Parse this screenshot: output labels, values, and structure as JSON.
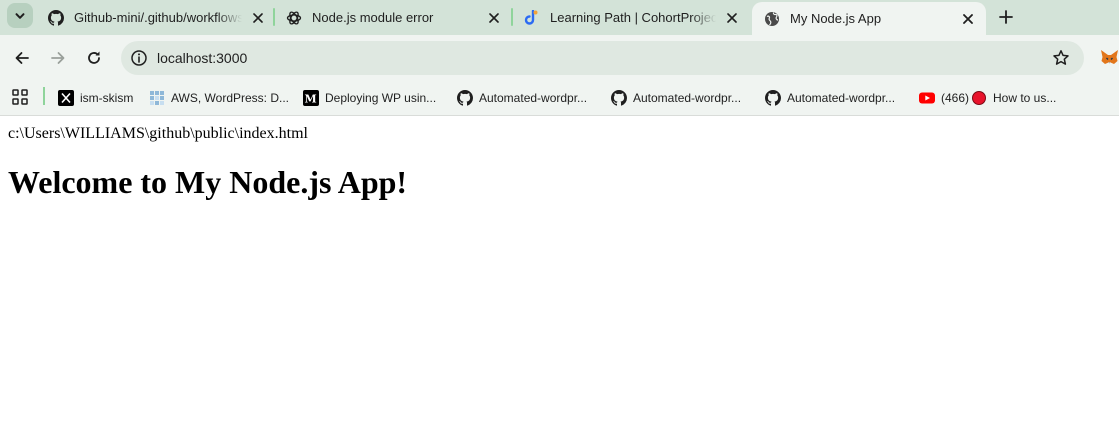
{
  "browser": {
    "tabs": [
      {
        "title": "Github-mini/.github/workflows/",
        "favicon": "github-icon",
        "active": false
      },
      {
        "title": "Node.js module error",
        "favicon": "openai-icon",
        "active": false
      },
      {
        "title": "Learning Path | CohortProject | ",
        "favicon": "cohort-icon",
        "active": false
      },
      {
        "title": "My Node.js App",
        "favicon": "globe-icon",
        "active": true
      }
    ],
    "address": "localhost:3000",
    "bookmarks": [
      {
        "label": "ism-skism",
        "icon": "x-icon"
      },
      {
        "label": "AWS, WordPress: D...",
        "icon": "aws-grid-icon"
      },
      {
        "label": "Deploying WP usin...",
        "icon": "medium-icon"
      },
      {
        "label": "Automated-wordpr...",
        "icon": "github-icon"
      },
      {
        "label": "Automated-wordpr...",
        "icon": "github-icon"
      },
      {
        "label": "Automated-wordpr...",
        "icon": "github-icon"
      },
      {
        "label": "(466)",
        "icon": "youtube-icon"
      },
      {
        "label": "How to us...",
        "icon": "red-dot-icon"
      }
    ],
    "colors": {
      "tabstrip": "#d3e3d8",
      "toolbar": "#f0f4f1",
      "omnibox": "#dfe8e1",
      "accent": "#8fd49b"
    }
  },
  "page": {
    "path_text": "c:\\Users\\WILLIAMS\\github\\public\\index.html",
    "heading": "Welcome to My Node.js App!"
  }
}
